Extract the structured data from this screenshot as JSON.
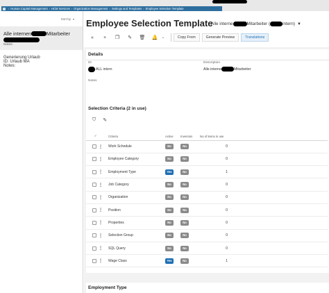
{
  "breadcrumb": {
    "items": [
      "Human Capital Management",
      "HCM Services",
      "Organization Management",
      "Settings and Templates",
      "Employee Selection Template"
    ]
  },
  "list": {
    "sort_label": "Sort by",
    "items": [
      {
        "title_prefix": "Alle internen",
        "title_suffix": "Mitarbeiter",
        "notes_label": "Notes:",
        "selected": true
      },
      {
        "title": "Generierung Urlaub",
        "id_label": "ID:",
        "id_value": "Urlaub MA",
        "notes_label": "Notes:",
        "selected": false
      }
    ]
  },
  "header": {
    "title": "Employee Selection Template",
    "subtitle_prefix": "Alle interne",
    "subtitle_middle": "Mitarbeiter (",
    "subtitle_suffix": "intern)"
  },
  "toolbar": {
    "copy_from": "Copy From",
    "generate_preview": "Generate Preview",
    "translations": "Translations"
  },
  "details": {
    "section_title": "Details",
    "id_label": "ID",
    "id_value_suffix": "ALL intern",
    "description_label": "Description",
    "description_prefix": "Alle interne",
    "description_suffix": "Mitarbeiter",
    "notes_label": "Notes"
  },
  "criteria": {
    "section_title": "Selection Criteria (2 in use)",
    "columns": {
      "criteria": "Criteria",
      "active": "Active",
      "inversion": "Inversion",
      "count": "No of items in use"
    },
    "rows": [
      {
        "name": "Work Schedule",
        "active": "No",
        "inversion": "No",
        "count": "0"
      },
      {
        "name": "Employee Category",
        "active": "No",
        "inversion": "No",
        "count": "0"
      },
      {
        "name": "Employment Type",
        "active": "Yes",
        "inversion": "No",
        "count": "1"
      },
      {
        "name": "Job Category",
        "active": "No",
        "inversion": "No",
        "count": "0"
      },
      {
        "name": "Organization",
        "active": "No",
        "inversion": "No",
        "count": "0"
      },
      {
        "name": "Position",
        "active": "No",
        "inversion": "No",
        "count": "0"
      },
      {
        "name": "Properties",
        "active": "No",
        "inversion": "No",
        "count": "0"
      },
      {
        "name": "Selection Group",
        "active": "No",
        "inversion": "No",
        "count": "0"
      },
      {
        "name": "SQL Query",
        "active": "No",
        "inversion": "No",
        "count": "0"
      },
      {
        "name": "Wage Class",
        "active": "Yes",
        "inversion": "No",
        "count": "1"
      }
    ]
  },
  "employment_type": {
    "section_title": "Employment Type"
  },
  "colors": {
    "accent": "#1f6fb5",
    "breadcrumb_bg": "#2d6e9e",
    "pill_no": "#8a8a8a"
  }
}
